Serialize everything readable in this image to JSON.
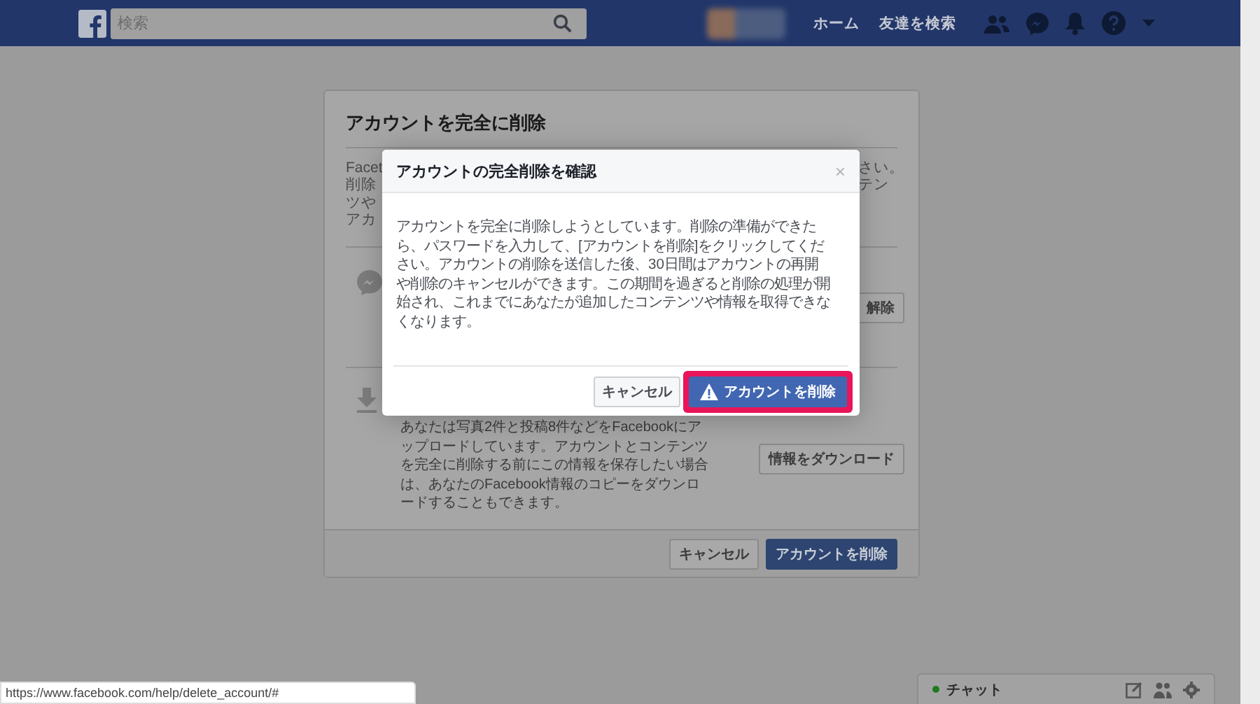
{
  "topbar": {
    "search_placeholder": "検索",
    "nav_links": [
      "ホーム",
      "友達を検索"
    ]
  },
  "card": {
    "title": "アカウントを完全に削除",
    "intro_left": [
      "Facet",
      "削除",
      "ツや",
      "アカ"
    ],
    "intro_right": [
      "さい。",
      "テン"
    ],
    "messenger_button": "解除",
    "download_text": "あなたは写真2件と投稿8件などをFacebookにアップロードしています。アカウントとコンテンツを完全に削除する前にこの情報を保存したい場合は、あなたのFacebook情報のコピーをダウンロードすることもできます。",
    "download_button": "情報をダウンロード",
    "buttons": [
      "キャンセル",
      "アカウントを削除"
    ]
  },
  "dialog": {
    "title": "アカウントの完全削除を確認",
    "close": "×",
    "body": "アカウントを完全に削除しようとしています。削除の準備ができたら、パスワードを入力して、[アカウントを削除]をクリックしてください。アカウントの削除を送信した後、30日間はアカウントの再開や削除のキャンセルができます。この期間を過ぎると削除の処理が開始され、これまでにあなたが追加したコンテンツや情報を取得できなくなります。",
    "cancel": "キャンセル",
    "confirm": "アカウントを削除",
    "confirm_highlighted": true
  },
  "status_url": "https://www.facebook.com/help/delete_account/#",
  "chat": {
    "label": "チャット",
    "online": true
  }
}
